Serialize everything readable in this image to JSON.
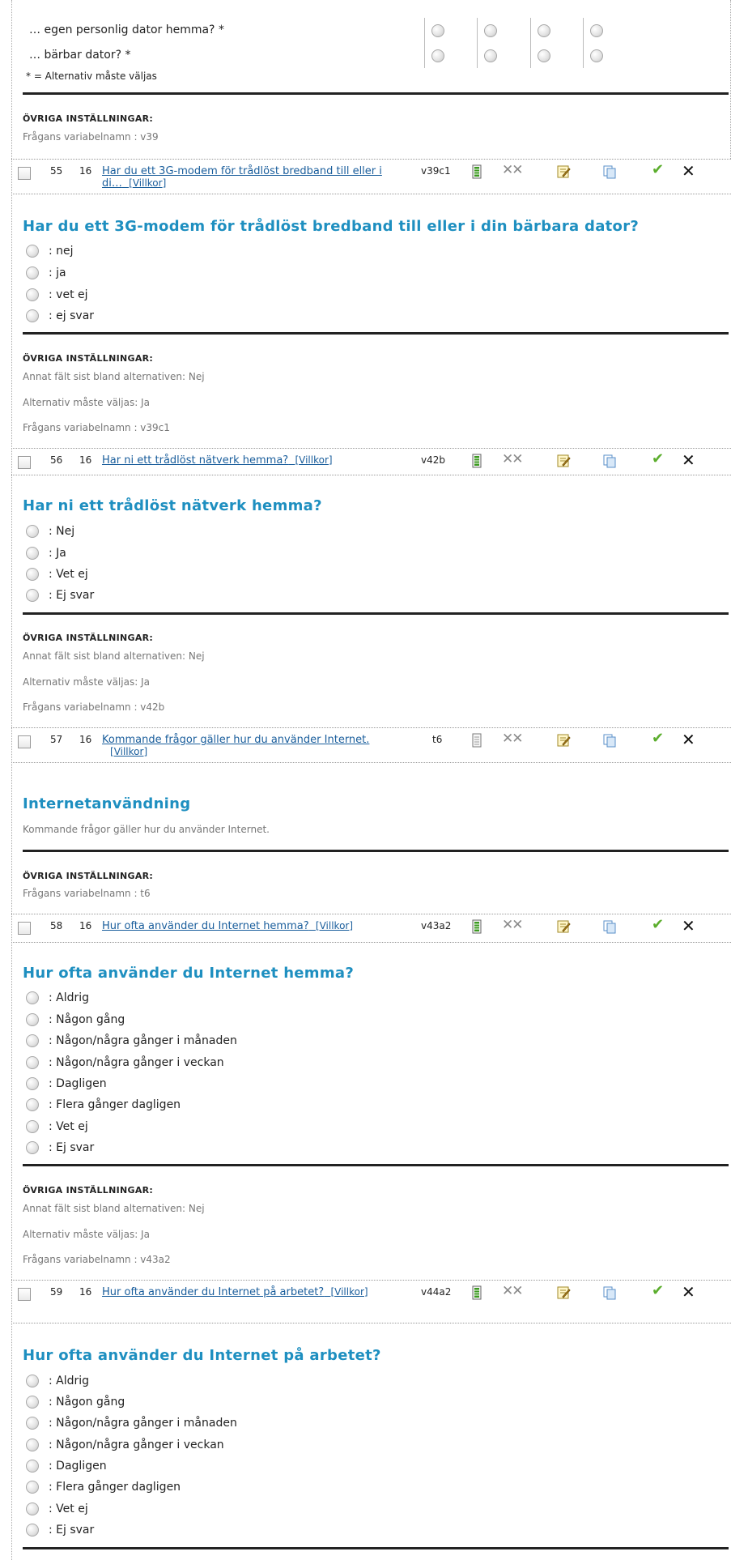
{
  "top": {
    "row1_label": "… egen personlig dator hemma? *",
    "row2_label": "… bärbar dator? *",
    "required_note": "* = Alternativ måste väljas",
    "settings_heading": "ÖVRIGA INSTÄLLNINGAR:",
    "varname": "Frågans variabelnamn : v39"
  },
  "q55": {
    "num": "55",
    "section": "16",
    "link_line1": "Har du ett 3G-modem för trådlöst bredband till eller i",
    "link_line2": "di…",
    "villkor": "Villkor",
    "code": "v39c1",
    "title": "Har du ett 3G-modem för trådlöst bredband till eller i din bärbara dator?",
    "options": [
      ": nej",
      ": ja",
      ": vet ej",
      ": ej svar"
    ],
    "settings_heading": "ÖVRIGA INSTÄLLNINGAR:",
    "annat": "Annat fält sist bland alternativen: Nej",
    "maste": "Alternativ måste väljas: Ja",
    "varname": "Frågans variabelnamn : v39c1"
  },
  "q56": {
    "num": "56",
    "section": "16",
    "link": "Har ni ett trådlöst nätverk hemma?",
    "villkor": "Villkor",
    "code": "v42b",
    "title": "Har ni ett trådlöst nätverk hemma?",
    "options": [
      ": Nej",
      ": Ja",
      ": Vet ej",
      ": Ej svar"
    ],
    "settings_heading": "ÖVRIGA INSTÄLLNINGAR:",
    "annat": "Annat fält sist bland alternativen: Nej",
    "maste": "Alternativ måste väljas: Ja",
    "varname": "Frågans variabelnamn : v42b"
  },
  "q57": {
    "num": "57",
    "section": "16",
    "link": "Kommande frågor gäller hur du använder Internet.",
    "villkor": "Villkor",
    "code": "t6",
    "title": "Internetanvändning",
    "description": "Kommande frågor gäller hur du använder Internet.",
    "settings_heading": "ÖVRIGA INSTÄLLNINGAR:",
    "varname": "Frågans variabelnamn : t6"
  },
  "q58": {
    "num": "58",
    "section": "16",
    "link": "Hur ofta använder du Internet hemma?",
    "villkor": "Villkor",
    "code": "v43a2",
    "title": "Hur ofta använder du Internet hemma?",
    "options": [
      ": Aldrig",
      ": Någon gång",
      ": Någon/några gånger i månaden",
      ": Någon/några gånger i veckan",
      ": Dagligen",
      ": Flera gånger dagligen",
      ": Vet ej",
      ": Ej svar"
    ],
    "settings_heading": "ÖVRIGA INSTÄLLNINGAR:",
    "annat": "Annat fält sist bland alternativen: Nej",
    "maste": "Alternativ måste väljas: Ja",
    "varname": "Frågans variabelnamn : v43a2"
  },
  "q59": {
    "num": "59",
    "section": "16",
    "link": "Hur ofta använder du Internet på arbetet?",
    "villkor": "Villkor",
    "code": "v44a2",
    "title": "Hur ofta använder du Internet på arbetet?",
    "options": [
      ": Aldrig",
      ": Någon gång",
      ": Någon/några gånger i månaden",
      ": Någon/några gånger i veckan",
      ": Dagligen",
      ": Flera gånger dagligen",
      ": Vet ej",
      ": Ej svar"
    ]
  },
  "icons": [
    "question-type-icon",
    "delete-answers-icon",
    "edit-icon",
    "copy-icon",
    "approve-icon",
    "delete-icon"
  ],
  "colors": {
    "title": "#1e8fc0",
    "link": "#1a5e9c",
    "check": "#5cae2e"
  }
}
